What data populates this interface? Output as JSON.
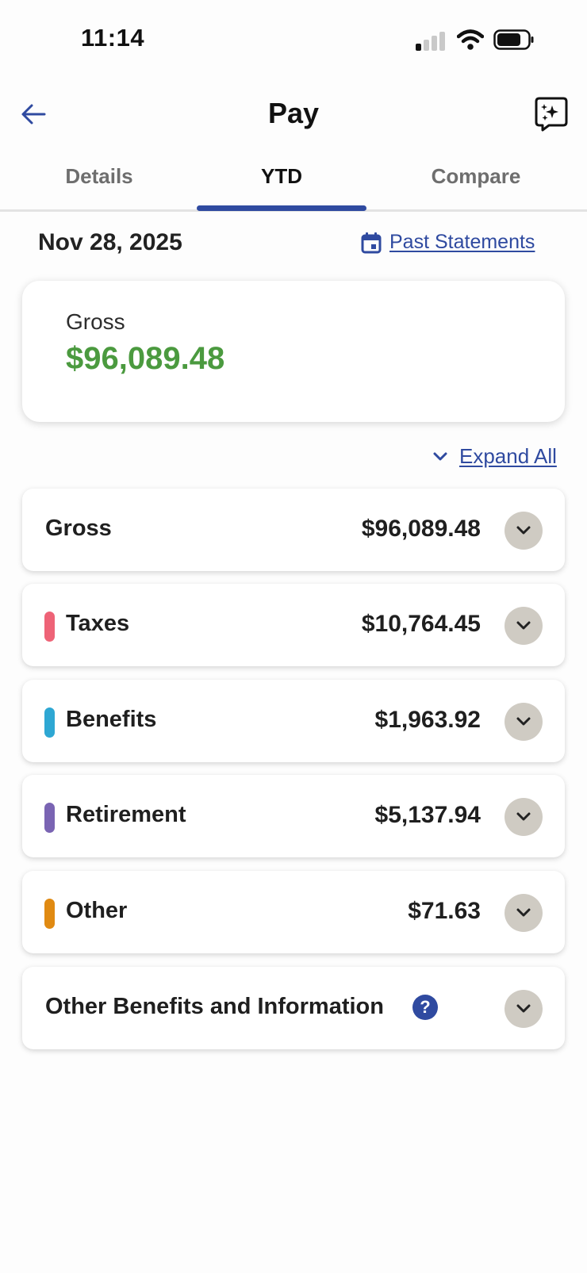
{
  "status_bar": {
    "time": "11:14"
  },
  "header": {
    "title": "Pay",
    "back_icon": "arrow-left-icon",
    "ai_icon": "sparkle-chat-icon"
  },
  "tabs": [
    {
      "label": "Details",
      "active": false
    },
    {
      "label": "YTD",
      "active": true
    },
    {
      "label": "Compare",
      "active": false
    }
  ],
  "statement": {
    "date": "Nov 28, 2025",
    "past_statements_label": "Past Statements"
  },
  "summary": {
    "label": "Gross",
    "value": "$96,089.48"
  },
  "expand_all_label": "Expand All",
  "categories": [
    {
      "label": "Gross",
      "amount": "$96,089.48",
      "color": null
    },
    {
      "label": "Taxes",
      "amount": "$10,764.45",
      "color": "#ee6377"
    },
    {
      "label": "Benefits",
      "amount": "$1,963.92",
      "color": "#2ea7d3"
    },
    {
      "label": "Retirement",
      "amount": "$5,137.94",
      "color": "#7a64b3"
    },
    {
      "label": "Other",
      "amount": "$71.63",
      "color": "#e08a12"
    }
  ],
  "other_info": {
    "label": "Other Benefits and Information",
    "help_glyph": "?"
  },
  "colors": {
    "accent": "#2f4aa0",
    "gross_green": "#4b9a3f",
    "chevron_bg": "#cfcbc3"
  }
}
